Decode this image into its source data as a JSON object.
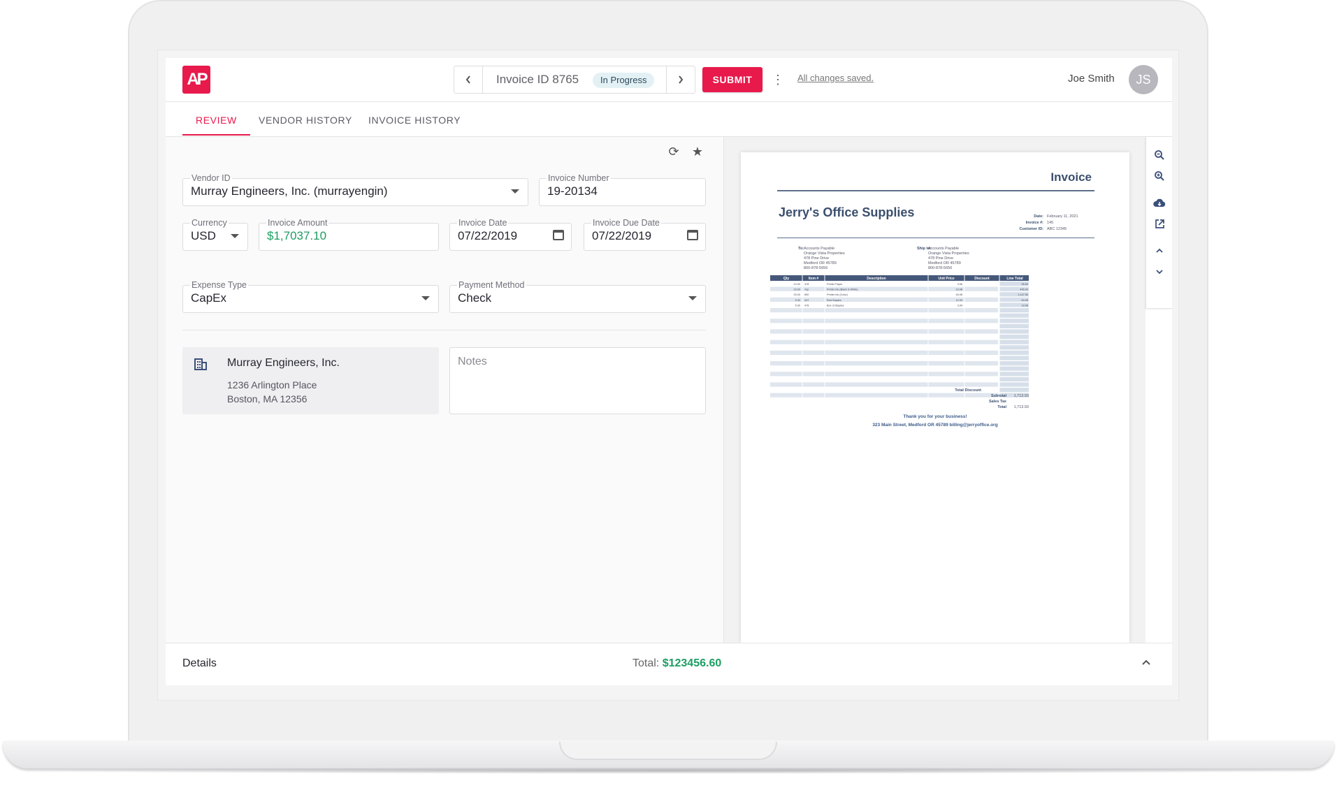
{
  "header": {
    "logo_text": "AP",
    "invoice_label": "Invoice ID 8765",
    "status": "In Progress",
    "submit_label": "SUBMIT",
    "saved_text": "All changes saved.",
    "user_name": "Joe Smith",
    "user_initials": "JS",
    "brand_color": "#e8194b"
  },
  "tabs": [
    {
      "label": "REVIEW",
      "active": true
    },
    {
      "label": "VENDOR HISTORY",
      "active": false
    },
    {
      "label": "INVOICE HISTORY",
      "active": false
    }
  ],
  "form": {
    "vendor_id": {
      "label": "Vendor ID",
      "value": "Murray Engineers, Inc. (murrayengin)"
    },
    "invoice_number": {
      "label": "Invoice Number",
      "value": "19-20134"
    },
    "currency": {
      "label": "Currency",
      "value": "USD"
    },
    "invoice_amount": {
      "label": "Invoice Amount",
      "value": "$1,7037.10"
    },
    "invoice_date": {
      "label": "Invoice Date",
      "value": "07/22/2019"
    },
    "invoice_due_date": {
      "label": "Invoice Due Date",
      "value": "07/22/2019"
    },
    "expense_type": {
      "label": "Expense Type",
      "value": "CapEx"
    },
    "payment_method": {
      "label": "Payment Method",
      "value": "Check"
    },
    "notes_placeholder": "Notes"
  },
  "vendor": {
    "name": "Murray Engineers, Inc.",
    "address_line1": "1236 Arlington Place",
    "address_line2": "Boston, MA 12356"
  },
  "document": {
    "title": "Invoice",
    "company": "Jerry's Office Supplies",
    "meta": [
      {
        "label": "Date:",
        "value": "February 11, 2021"
      },
      {
        "label": "Invoice #:",
        "value": "145"
      },
      {
        "label": "Customer ID:",
        "value": "ABC 12345"
      }
    ],
    "to_label": "To:",
    "to_lines": [
      "Accounts Payable",
      "Orange Vista Properties",
      "478 Pine Drive",
      "Medford OR 45789",
      "800-878-5656"
    ],
    "ship_label": "Ship to:",
    "ship_lines": [
      "Accounts Payable",
      "Orange Vista Properties",
      "478 Pine Drive",
      "Medford OR 45789",
      "800-878-5656"
    ],
    "columns": [
      "Qty",
      "Item #",
      "Description",
      "Unit Price",
      "Discount",
      "Line Total"
    ],
    "rows": [
      [
        "10.00",
        "478",
        "Printer Paper",
        "3.56",
        "",
        "35.60"
      ],
      [
        "23.00",
        "7ep",
        "Printer Ink (Black & White)",
        "23.98",
        "",
        "445.93"
      ],
      [
        "25.00",
        "890",
        "Printer Ink (Color)",
        "45.98",
        "",
        "1,147.50"
      ],
      [
        "5.00",
        "447",
        "Red Staples",
        "12.99",
        "",
        "64.95"
      ],
      [
        "5.00",
        "478",
        "Box of Staples",
        "3.99",
        "",
        "19.95"
      ]
    ],
    "total_discount_label": "Total Discount",
    "subtotal_label": "Subtotal",
    "subtotal_value": "1,713.93",
    "sales_tax_label": "Sales Tax",
    "total_label": "Total",
    "total_value": "1,713.93",
    "thanks": "Thank you for your business!",
    "footer": "323 Main Street, Medford OR 45789 billing@jerryoffice.org"
  },
  "details": {
    "label": "Details",
    "total_label": "Total:",
    "total_value": "$123456.60"
  }
}
